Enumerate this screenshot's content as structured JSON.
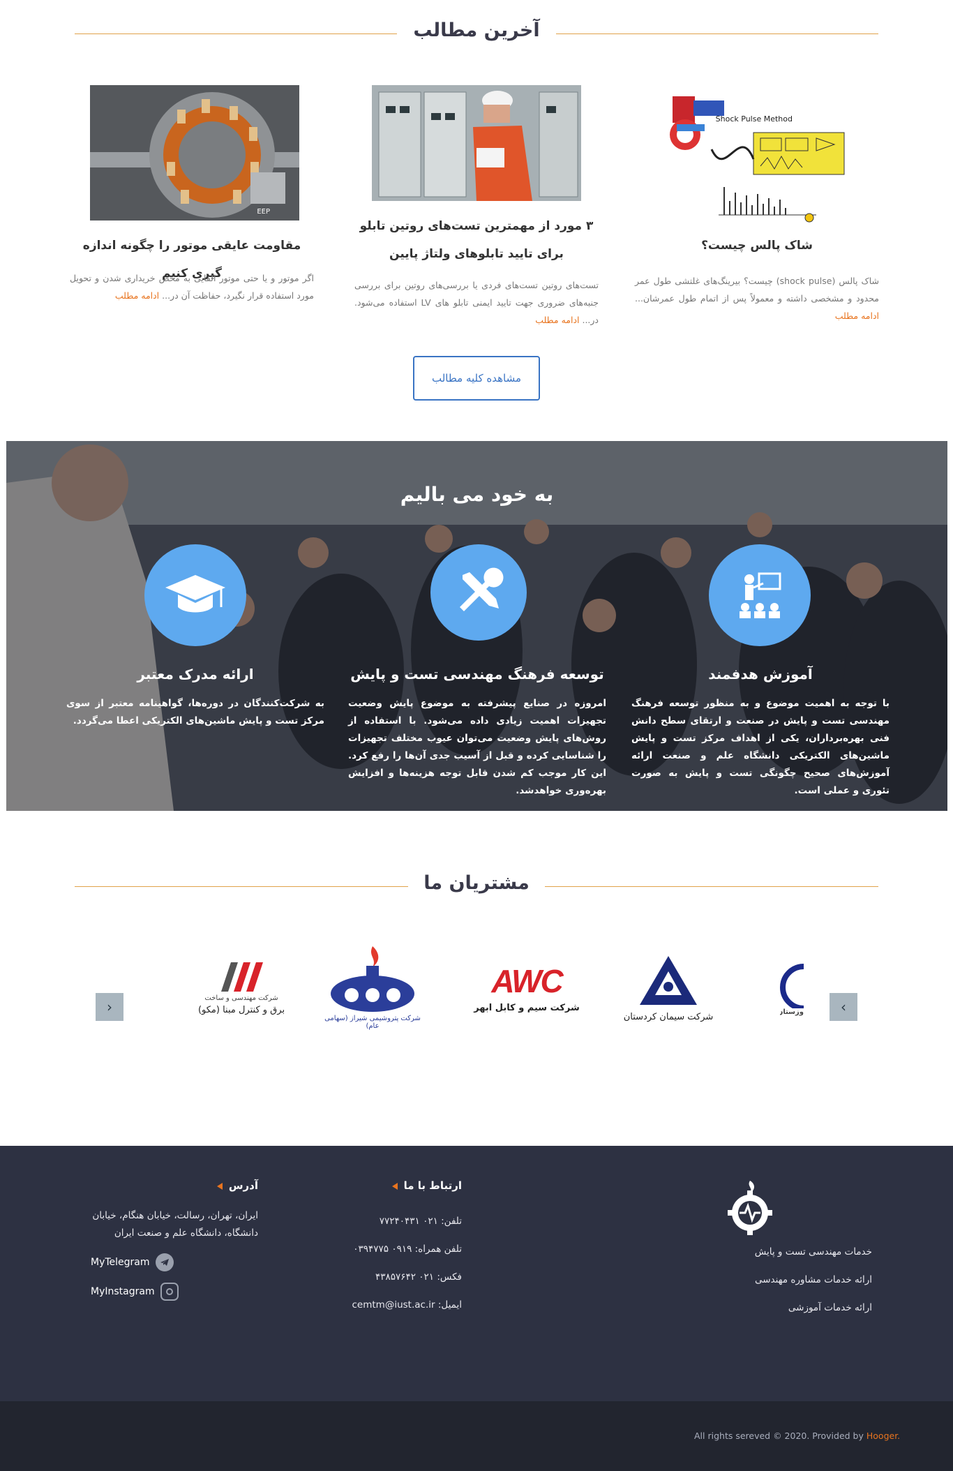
{
  "latest": {
    "title": "آخرین مطالب",
    "view_all": "مشاهده کلیه مطالب",
    "posts": [
      {
        "title": "شاک پالس چیست؟",
        "excerpt": "شاک پالس (shock pulse) چیست؟ بیرینگ‌های غلتشی طول عمر محدود و مشخصی داشته و معمولاً پس از اتمام طول عمرشان...",
        "more": "ادامه مطلب",
        "image_caption": "Shock Pulse Method"
      },
      {
        "title": "۳ مورد از مهمترین تست‌های روتین تابلو برای تایید تابلوهای ولتاژ پایین",
        "excerpt": "تست‌های روتین تست‌های فردی یا بررسی‌های روتین برای بررسی جنبه‌های ضروری جهت تایید ایمنی تابلو های LV استفاده می‌شود. در...",
        "more": "ادامه مطلب"
      },
      {
        "title": "مقاومت عایقی موتور را چگونه اندازه گیری کنیم",
        "excerpt": "اگر موتور و یا حتی موتور القایی به محض خریداری شدن و تحویل مورد استفاده قرار نگیرد، حفاظت آن در...",
        "more": "ادامه مطلب"
      }
    ]
  },
  "pride": {
    "title": "به خود می بالیم",
    "features": [
      {
        "icon": "presentation-icon",
        "title": "آموزش هدفمند",
        "text": "با توجه به اهمیت موضوع و به منظور توسعه فرهنگ مهندسی تست و پایش در صنعت و ارتقای سطح دانش فنی بهره‌برداران، یکی از اهداف مرکز تست و پایش ماشین‌های الکتریکی دانشگاه علم و صنعت ارائه آموزش‌های صحیح چگونگی تست و پایش به صورت تئوری و عملی است."
      },
      {
        "icon": "tools-icon",
        "title": "توسعه فرهنگ مهندسی تست و پایش",
        "text": "امروزه در صنایع پیشرفته به موضوع پایش وضعیت تجهیزات اهمیت زیادی داده می‌شود. با استفاده از روش‌های پایش وضعیت می‌توان عیوب مختلف تجهیزات را شناسایی کرده و قبل از آسیب جدی آن‌ها را رفع کرد. این کار موجب کم شدن قابل توجه هزینه‌ها و افزایش بهره‌وری خواهدشد."
      },
      {
        "icon": "graduation-cap-icon",
        "title": "ارائه مدرک معتبر",
        "text": "به شرکت‌کنندگان در دوره‌ها، گواهینامه معتبر از سوی مرکز تست و پایش ماشین‌های الکتریکی اعطا می‌گردد."
      }
    ]
  },
  "clients": {
    "title": "مشتریان ما",
    "logos": [
      {
        "name": "partial-logo",
        "caption": "وزستان"
      },
      {
        "name": "kordestan-cement",
        "caption": "شرکت سیمان کردستان"
      },
      {
        "name": "abhar-cable",
        "caption": "شرکت سیم و کابل ابهر",
        "mark": "AWC"
      },
      {
        "name": "shiraz-petrochem",
        "caption": "شرکت پتروشیمی شیراز (سهامی عام)"
      },
      {
        "name": "mabna-control",
        "caption_top": "شرکت مهندسی و ساخت",
        "caption": "برق و کنترل مبنا (مکو)"
      }
    ],
    "prev": "‹",
    "next": "›"
  },
  "footer": {
    "services": [
      "خدمات مهندسی تست و پایش",
      "ارائه خدمات مشاوره مهندسی",
      "ارائه خدمات آموزشی"
    ],
    "contact": {
      "title": "ارتباط با ما",
      "phone": "تلفن: ۰۲۱ ۷۷۲۴۰۴۳۱",
      "mobile": "تلفن همراه: ۰۹۱۹ ۰۳۹۴۷۷۵",
      "fax": "فکس: ۰۲۱ ۴۳۸۵۷۶۴۲",
      "email": "ایمیل: cemtm@iust.ac.ir"
    },
    "address": {
      "title": "آدرس",
      "text": "ایران، تهران، رسالت، خیابان هنگام، خیابان دانشگاه، دانشگاه علم و صنعت ایران",
      "telegram": "MyTelegram",
      "instagram": "MyInstagram"
    },
    "copyright": "All rights sereved © 2020. Provided by",
    "brand": "Hooger."
  }
}
